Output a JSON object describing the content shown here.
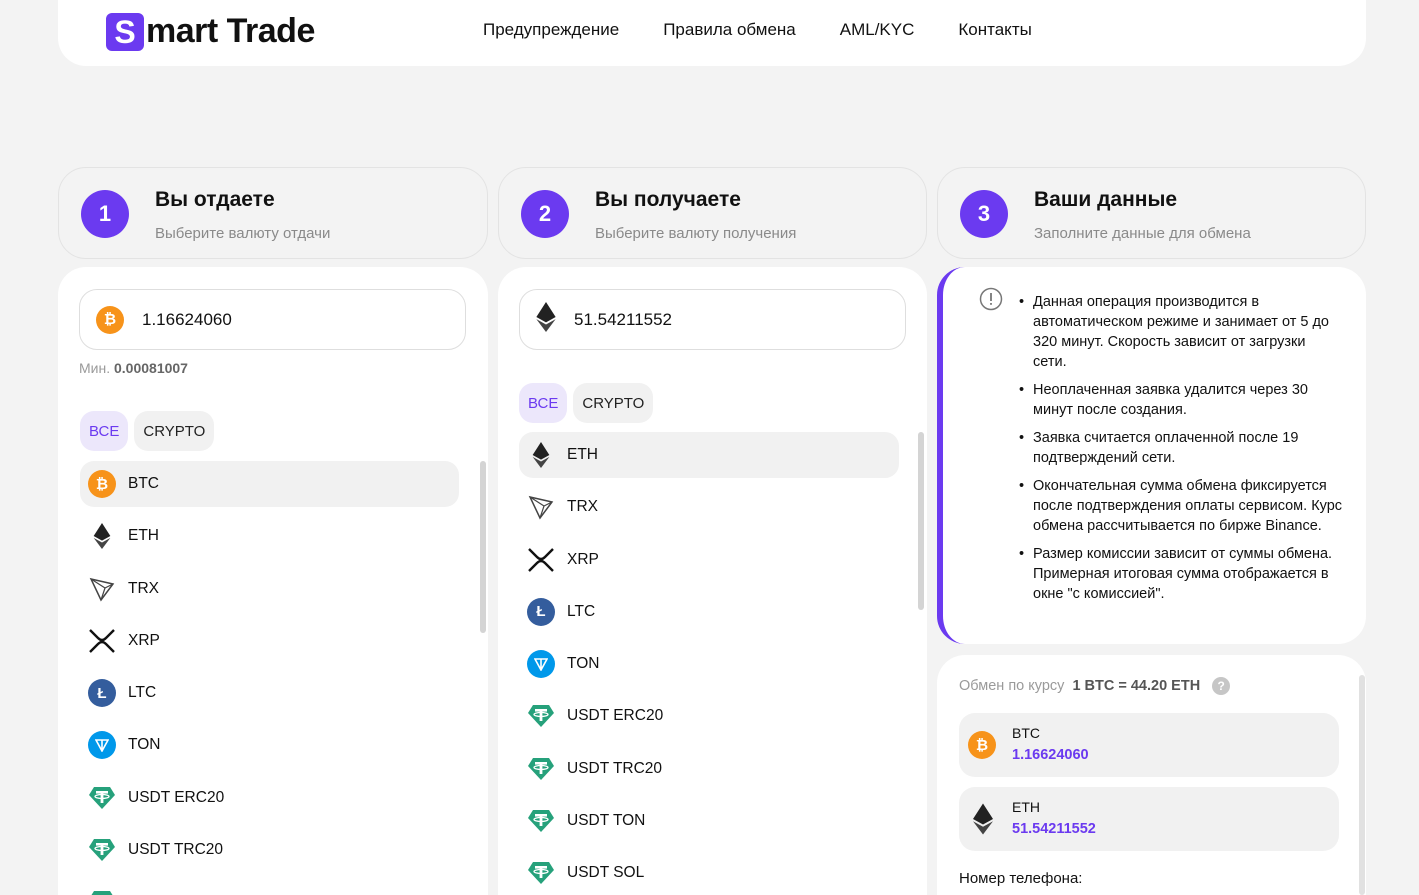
{
  "logo": {
    "letter": "S",
    "text": "mart Trade"
  },
  "nav": [
    "Предупреждение",
    "Правила обмена",
    "AML/KYC",
    "Контакты"
  ],
  "steps": [
    {
      "num": "1",
      "title": "Вы отдаете",
      "sub": "Выберите валюту отдачи"
    },
    {
      "num": "2",
      "title": "Вы получаете",
      "sub": "Выберите валюту получения"
    },
    {
      "num": "3",
      "title": "Ваши данные",
      "sub": "Заполните данные для обмена"
    }
  ],
  "give": {
    "amount": "1.16624060",
    "min_label": "Мин.",
    "min_value": "0.00081007",
    "chips": [
      "ВСЕ",
      "CRYPTO"
    ],
    "list": [
      "BTC",
      "ETH",
      "TRX",
      "XRP",
      "LTC",
      "TON",
      "USDT ERC20",
      "USDT TRC20"
    ]
  },
  "get": {
    "amount": "51.54211552",
    "chips": [
      "ВСЕ",
      "CRYPTO"
    ],
    "list": [
      "ETH",
      "TRX",
      "XRP",
      "LTC",
      "TON",
      "USDT ERC20",
      "USDT TRC20",
      "USDT TON",
      "USDT SOL"
    ]
  },
  "info": [
    "Данная операция производится в автоматическом режиме и занимает от 5 до 320 минут. Скорость зависит от загрузки сети.",
    "Неоплаченная заявка удалится через 30 минут после создания.",
    "Заявка считается оплаченной после 19 подтверждений сети.",
    "Окончательная сумма обмена фиксируется после подтверждения оплаты сервисом. Курс обмена рассчитывается по бирже Binance.",
    "Размер комиссии зависит от суммы обмена. Примерная итоговая сумма отображается в окне \"с комиссией\"."
  ],
  "summary": {
    "rate_label": "Обмен по курсу",
    "rate_value": "1 BTC = 44.20 ETH",
    "give_cur": "BTC",
    "give_amount": "1.16624060",
    "get_cur": "ETH",
    "get_amount": "51.54211552",
    "phone_label": "Номер телефона:"
  },
  "colors": {
    "accent": "#6b3af0",
    "btc": "#f7931a",
    "ltc": "#345d9d",
    "ton": "#0098ea",
    "usdt": "#26a17b"
  }
}
